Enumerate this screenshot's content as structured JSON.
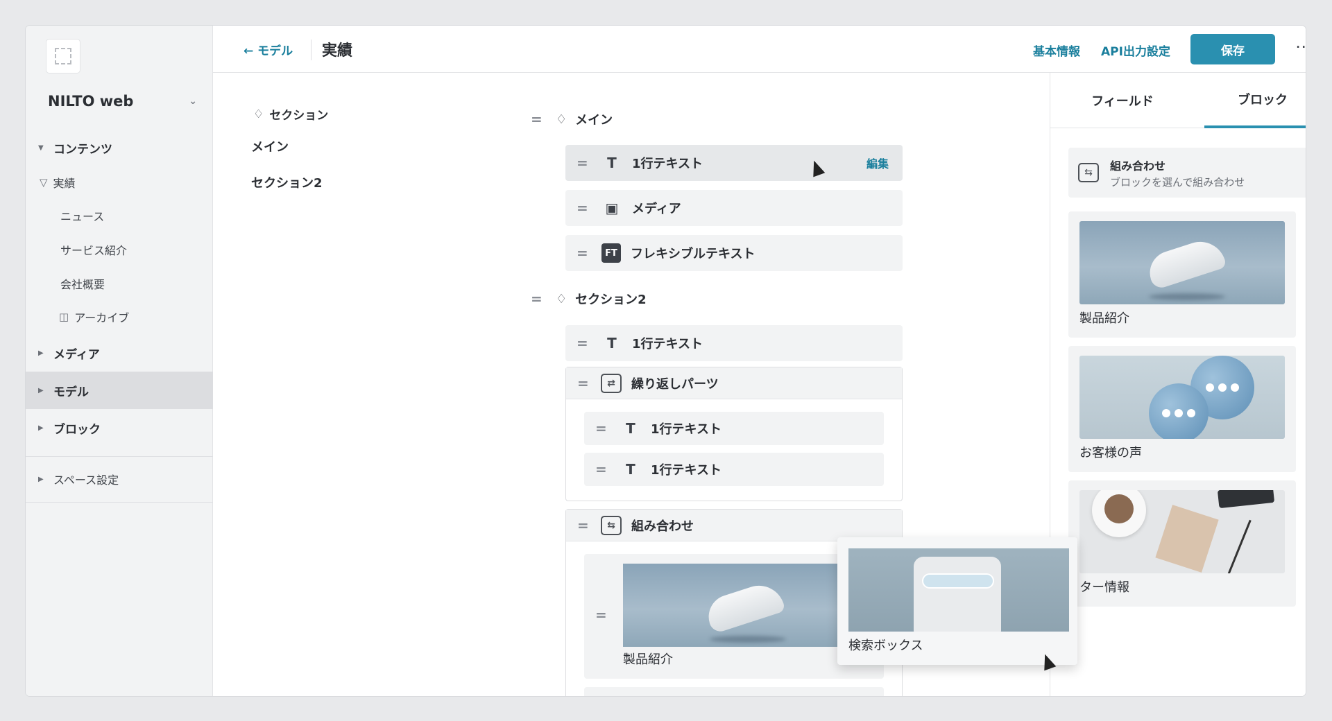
{
  "sidebar": {
    "space_name": "NILTO web",
    "contents_label": "コンテンツ",
    "contents_items": [
      "実績",
      "ニュース",
      "サービス紹介",
      "会社概要",
      "アーカイブ"
    ],
    "media_label": "メディア",
    "model_label": "モデル",
    "block_label": "ブロック",
    "space_settings_label": "スペース設定"
  },
  "header": {
    "back_label": "モデル",
    "title": "実績",
    "basic_info_label": "基本情報",
    "api_output_label": "API出力設定",
    "save_label": "保存"
  },
  "sections": {
    "heading": "セクション",
    "items": [
      "メイン",
      "セクション2"
    ]
  },
  "tree": {
    "main_group": "メイン",
    "main_fields": [
      "1行テキスト",
      "メディア",
      "フレキシブルテキスト"
    ],
    "edit_label": "編集",
    "section2_group": "セクション2",
    "section2_field": "1行テキスト",
    "repeat_label": "繰り返しパーツ",
    "repeat_children": [
      "1行テキスト",
      "1行テキスト"
    ],
    "combo_label": "組み合わせ",
    "combo_child_label": "製品紹介",
    "ft_icon_text": "FT"
  },
  "right_panel": {
    "tab_field": "フィールド",
    "tab_block": "ブロック",
    "combo_title": "組み合わせ",
    "combo_subtitle": "ブロックを選んで組み合わせ",
    "block_cards": [
      "製品紹介",
      "お客様の声",
      "ター情報"
    ]
  },
  "drag_ghost": {
    "label": "検索ボックス"
  },
  "colors": {
    "accent": "#2a90b0",
    "link": "#1a7f9d"
  }
}
